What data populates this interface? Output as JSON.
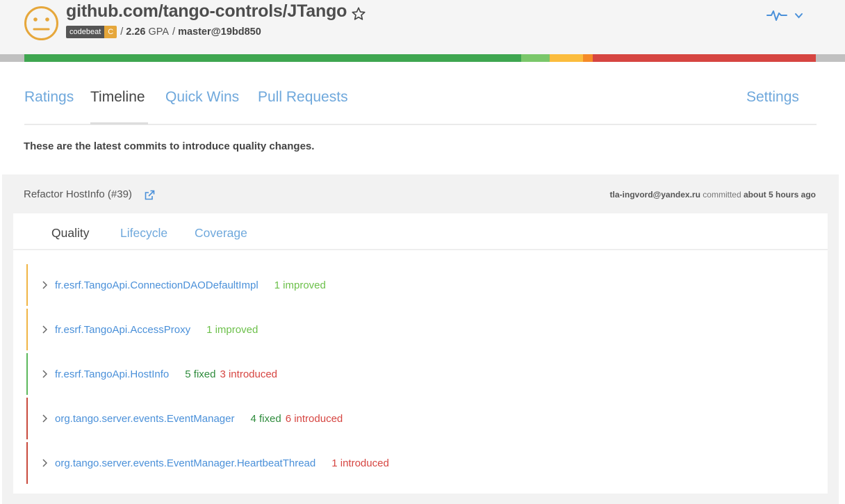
{
  "header": {
    "repo_title": "github.com/tango-controls/JTango",
    "badge_name": "codebeat",
    "badge_grade": "C",
    "badge_grade_color": "#e6a73b",
    "separator": "/",
    "gpa_value": "2.26",
    "gpa_label": "GPA",
    "branch": "master@19bd850",
    "icons": [
      "neutral-face-icon",
      "star-icon",
      "activity-icon",
      "chevron-down-icon"
    ]
  },
  "grade_distribution": {
    "colors": [
      "#3fa650",
      "#7ac76a",
      "#fbbc3d",
      "#f58a28",
      "#d64541"
    ],
    "fractions": [
      0.628,
      0.036,
      0.042,
      0.012,
      0.282
    ]
  },
  "nav": {
    "tabs": [
      "Ratings",
      "Timeline",
      "Quick Wins",
      "Pull Requests"
    ],
    "settings": "Settings",
    "active": "Timeline"
  },
  "intro_text": "These are the latest commits to introduce quality changes.",
  "commit": {
    "title": "Refactor HostInfo (#39)",
    "author": "tla-ingvord@yandex.ru",
    "action": "committed",
    "time": "about 5 hours ago",
    "subtabs": [
      "Quality",
      "Lifecycle",
      "Coverage"
    ],
    "active_subtab": "Quality",
    "entries": [
      {
        "class_name": "fr.esrf.TangoApi.ConnectionDAODefaultImpl",
        "improved": "1 improved",
        "fixed": "",
        "introduced": "",
        "status_color": "#f0b545"
      },
      {
        "class_name": "fr.esrf.TangoApi.AccessProxy",
        "improved": "1 improved",
        "fixed": "",
        "introduced": "",
        "status_color": "#f0b545"
      },
      {
        "class_name": "fr.esrf.TangoApi.HostInfo",
        "improved": "",
        "fixed": "5 fixed",
        "introduced": "3 introduced",
        "status_color": "#5cb85c"
      },
      {
        "class_name": "org.tango.server.events.EventManager",
        "improved": "",
        "fixed": "4 fixed",
        "introduced": "6 introduced",
        "status_color": "#c94a3d"
      },
      {
        "class_name": "org.tango.server.events.EventManager.HeartbeatThread",
        "improved": "",
        "fixed": "",
        "introduced": "1 introduced",
        "status_color": "#c94a3d"
      }
    ]
  }
}
